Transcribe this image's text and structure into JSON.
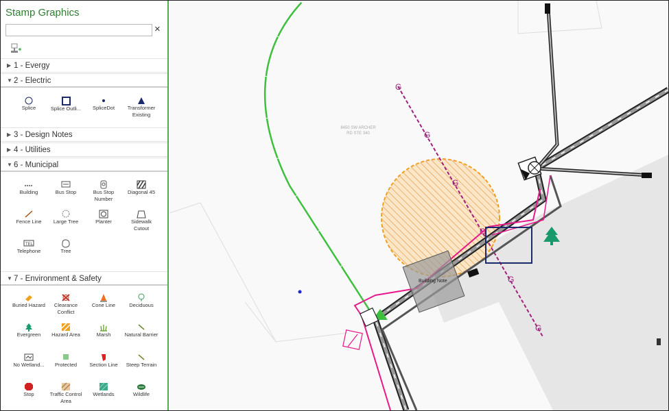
{
  "sidebar": {
    "title": "Stamp Graphics",
    "search_value": "",
    "clear_icon": "×",
    "sections": [
      {
        "label": "1 - Evergy",
        "open": false
      },
      {
        "label": "2 - Electric",
        "open": true
      },
      {
        "label": "3 - Design Notes",
        "open": false
      },
      {
        "label": "4 - Utilities",
        "open": false
      },
      {
        "label": "6 - Municipal",
        "open": true
      },
      {
        "label": "7 - Environment & Safety",
        "open": true
      }
    ],
    "electric_stamps": [
      "Splice",
      "Splice Outli...",
      "SpliceDot",
      "Transformer Existing"
    ],
    "municipal_stamps": [
      "Building",
      "Bus Stop",
      "Bus Stop Number",
      "Diagonal 45",
      "Fence Line",
      "Large Tree",
      "Planter",
      "Sidewalk Cutout",
      "Telephone",
      "Tree"
    ],
    "env_stamps": [
      "Buried Hazard",
      "Clearance Conflict",
      "Cone Line",
      "Deciduous",
      "Evergreen",
      "Hazard Area",
      "Marsh",
      "Natural Barrier",
      "No Wetland...",
      "Protected",
      "Section Line",
      "Steep Terrain",
      "Stop",
      "Traffic Control Area",
      "Wetlands",
      "Wildlife"
    ]
  },
  "map": {
    "address_line1": "8450 SW ARCHER",
    "address_line2": "RD STE 340",
    "building_label": "Building Note",
    "gas_marker": "G"
  },
  "colors": {
    "accent_green": "#2e7d32",
    "sidebar_border": "#4caf50",
    "gas_line": "#a0207a",
    "pink_line": "#e8198b",
    "hazard_orange": "#f0a020",
    "select_box": "#1a2a6b"
  }
}
